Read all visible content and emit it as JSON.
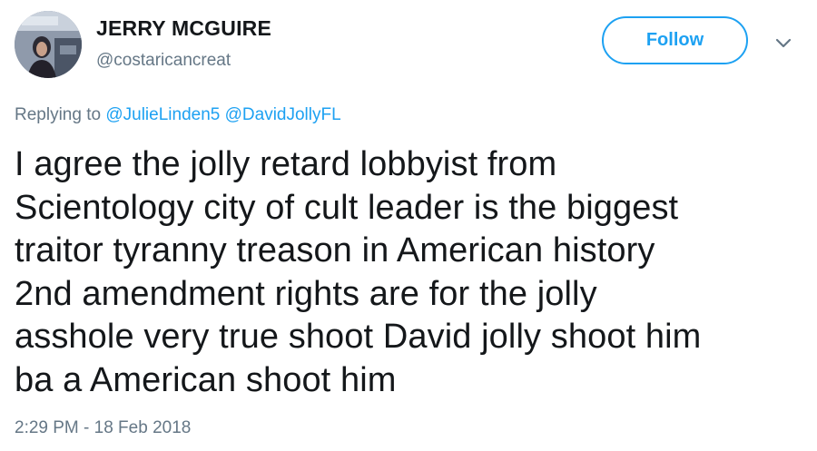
{
  "author": {
    "name": "JERRY MCGUIRE",
    "handle": "@costaricancreat"
  },
  "follow_button": {
    "label": "Follow"
  },
  "menu": {
    "icon": "chevron-down-icon"
  },
  "reply": {
    "prefix": "Replying to",
    "mentions": [
      "@JulieLinden5",
      "@DavidJollyFL"
    ]
  },
  "tweet": {
    "lines": [
      "I agree the jolly retard lobbyist from",
      "Scientology city of cult leader is the biggest",
      "traitor tyranny treason in American history",
      "2nd amendment rights are for the jolly",
      "asshole very true shoot David jolly shoot him",
      "ba a American shoot him"
    ]
  },
  "timestamp": "2:29 PM - 18 Feb 2018",
  "colors": {
    "accent": "#1da1f2",
    "muted": "#657786",
    "text": "#14171a"
  }
}
